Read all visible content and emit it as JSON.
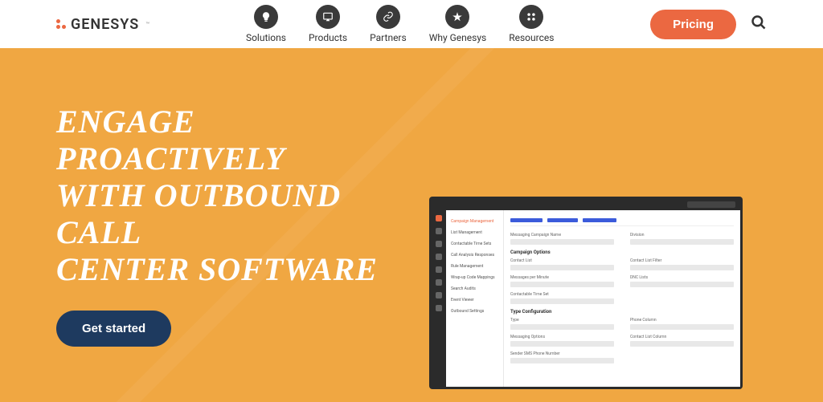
{
  "header": {
    "logo": "GENESYS",
    "nav": [
      {
        "label": "Solutions"
      },
      {
        "label": "Products"
      },
      {
        "label": "Partners"
      },
      {
        "label": "Why Genesys"
      },
      {
        "label": "Resources"
      }
    ],
    "pricing": "Pricing"
  },
  "hero": {
    "title_line1": "Engage proactively",
    "title_line2": "with outbound call",
    "title_line3": "center software",
    "cta": "Get started"
  },
  "mock": {
    "sidebar": [
      "Campaign Management",
      "List Management",
      "Contactable Time Sets",
      "Call Analysis Responses",
      "Rule Management",
      "Wrap-up Code Mappings",
      "Search Audits",
      "Event Viewer",
      "Outbound Settings"
    ],
    "sections": {
      "name_label": "Messaging Campaign Name",
      "division_label": "Division",
      "campaign_options": "Campaign Options",
      "contact_list": "Contact List",
      "contact_list_filter": "Contact List Filter",
      "messages_per_minute": "Messages per Minute",
      "dnc_lists": "DNC Lists",
      "contactable_time_set": "Contactable Time Set",
      "type_config": "Type Configuration",
      "type": "Type",
      "phone_column": "Phone Column",
      "messaging_options": "Messaging Options",
      "contact_list_column": "Contact List Column",
      "sender_sms": "Sender SMS Phone Number"
    }
  }
}
